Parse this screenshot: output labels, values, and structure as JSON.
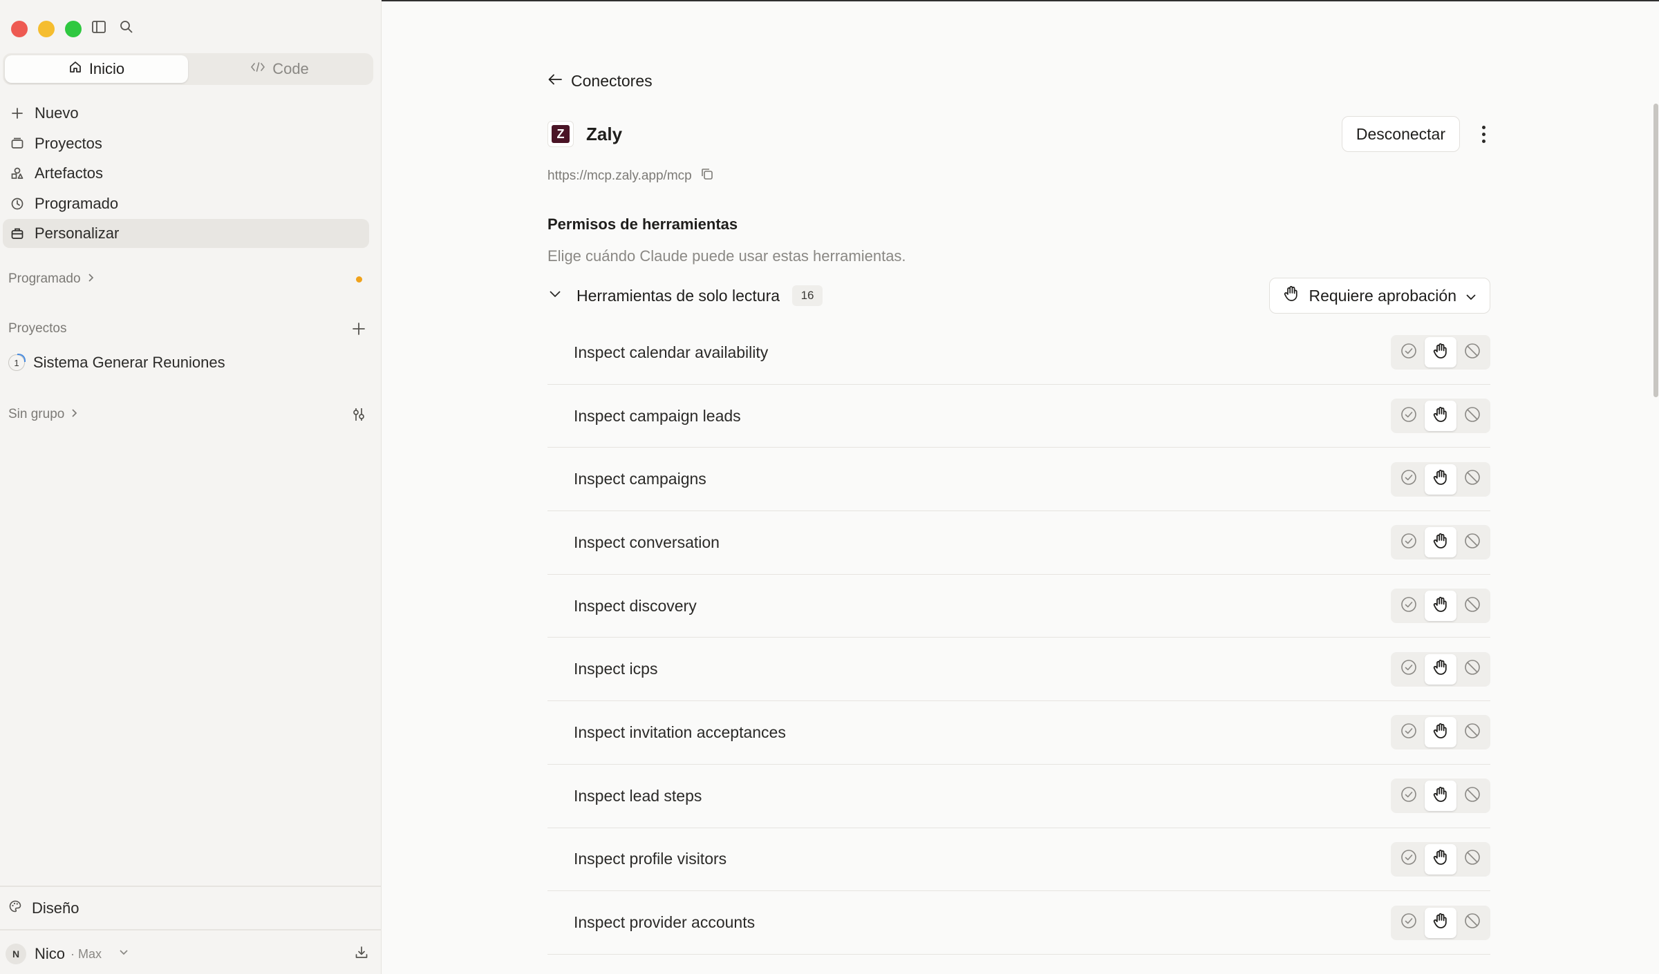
{
  "sidebar": {
    "mode_tabs": [
      {
        "label": "Inicio",
        "icon": "home-icon",
        "active": true
      },
      {
        "label": "Code",
        "icon": "code-icon",
        "active": false
      }
    ],
    "nav": [
      {
        "label": "Nuevo",
        "icon": "plus-icon"
      },
      {
        "label": "Proyectos",
        "icon": "folder-icon"
      },
      {
        "label": "Artefactos",
        "icon": "artifacts-icon"
      },
      {
        "label": "Programado",
        "icon": "clock-icon"
      },
      {
        "label": "Personalizar",
        "icon": "briefcase-icon",
        "active": true
      }
    ],
    "scheduled_section": "Programado",
    "projects_section": "Proyectos",
    "project_item": {
      "badge": "1",
      "label": "Sistema Generar Reuniones"
    },
    "ungrouped_section": "Sin grupo",
    "design": "Diseño",
    "user": {
      "initial": "N",
      "name": "Nico",
      "plan": "· Max"
    }
  },
  "main": {
    "back_label": "Conectores",
    "connector": {
      "logo_letter": "Z",
      "name": "Zaly",
      "url": "https://mcp.zaly.app/mcp"
    },
    "disconnect_label": "Desconectar",
    "permissions_title": "Permisos de herramientas",
    "permissions_desc": "Elige cuándo Claude puede usar estas herramientas.",
    "group": {
      "title": "Herramientas de solo lectura",
      "count": "16",
      "policy": "Requiere aprobación"
    },
    "tools": [
      "Inspect calendar availability",
      "Inspect campaign leads",
      "Inspect campaigns",
      "Inspect conversation",
      "Inspect discovery",
      "Inspect icps",
      "Inspect invitation acceptances",
      "Inspect lead steps",
      "Inspect profile visitors",
      "Inspect provider accounts"
    ],
    "tool_permission_selected": "require-approval"
  },
  "colors": {
    "accent_dot": "#f0a21b",
    "logo_bg": "#4a1426",
    "close": "#ee5a52",
    "minimize": "#f5bd2f",
    "zoom": "#2fc840"
  }
}
